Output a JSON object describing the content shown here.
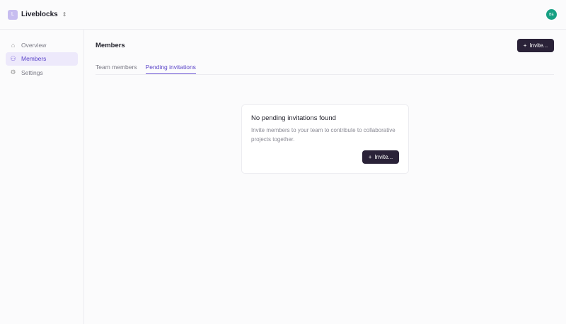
{
  "org": {
    "initial": "L",
    "name": "Liveblocks"
  },
  "user": {
    "initials": "BE",
    "color": "#17a083"
  },
  "sidebar": {
    "items": [
      {
        "label": "Overview",
        "icon": "home-icon"
      },
      {
        "label": "Members",
        "icon": "users-icon",
        "active": true
      },
      {
        "label": "Settings",
        "icon": "gear-icon"
      }
    ]
  },
  "main": {
    "title": "Members",
    "invite_label": "Invite...",
    "tabs": [
      {
        "label": "Team members"
      },
      {
        "label": "Pending invitations",
        "active": true
      }
    ]
  },
  "empty": {
    "title": "No pending invitations found",
    "description": "Invite members to your team to contribute to collaborative projects together.",
    "invite_label": "Invite..."
  },
  "accent": "#5b45c9"
}
